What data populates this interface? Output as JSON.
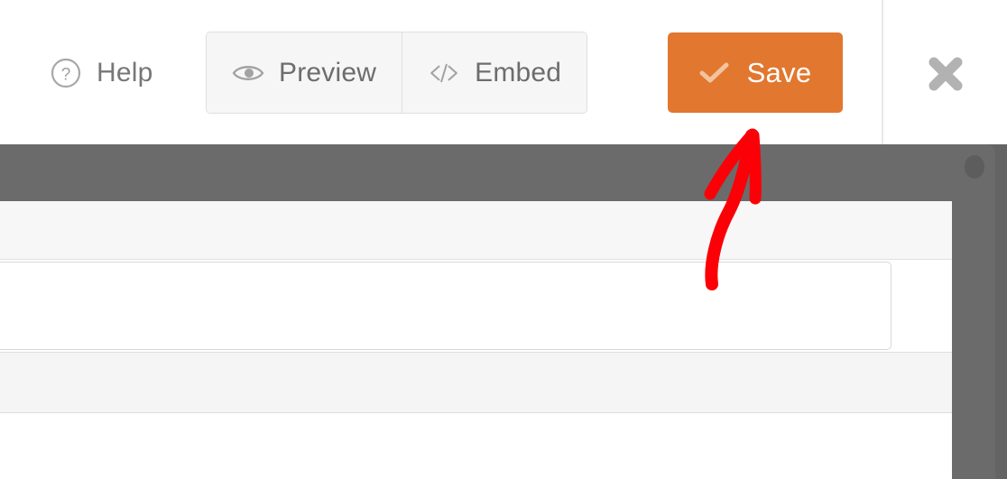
{
  "toolbar": {
    "help": {
      "label": "Help",
      "icon": "question-circle-icon"
    },
    "preview": {
      "label": "Preview",
      "icon": "eye-icon"
    },
    "embed": {
      "label": "Embed",
      "icon": "code-brackets-icon"
    },
    "save": {
      "label": "Save",
      "icon": "checkmark-icon"
    },
    "close": {
      "icon": "close-x-icon"
    }
  },
  "colors": {
    "save_button_bg": "#e2772f",
    "save_button_text": "#ffffff",
    "save_check": "#f3c39e",
    "toolbar_text": "#6d6d6d",
    "help_text": "#777777",
    "icon_gray": "#9b9b9b",
    "close_icon": "#b2b2b2",
    "button_group_bg": "#f6f6f6",
    "button_group_border": "#dfdfdf",
    "overlay_backdrop": "#6b6b6b",
    "panel_bg": "#f7f7f7",
    "panel_border": "#e0e0e0",
    "input_bg": "#ffffff",
    "input_border": "#d8d8d8",
    "annotation_red": "#fb0007"
  },
  "annotation": {
    "type": "hand-drawn-arrow",
    "points_to": "save-button",
    "color": "#fb0007"
  },
  "form_panel": {
    "header": "",
    "field_value": "",
    "field_placeholder": ""
  }
}
